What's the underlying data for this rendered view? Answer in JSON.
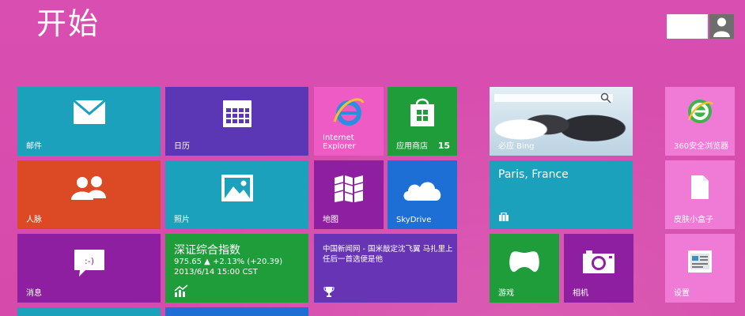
{
  "header": {
    "title": "开始",
    "user_name": ""
  },
  "tiles": {
    "mail": {
      "label": "邮件"
    },
    "calendar": {
      "label": "日历"
    },
    "ie": {
      "label_line1": "Internet",
      "label_line2": "Explorer"
    },
    "store": {
      "label": "应用商店",
      "badge": "15"
    },
    "bing": {
      "label": "必应 Bing"
    },
    "people": {
      "label": "人脉"
    },
    "photos": {
      "label": "照片"
    },
    "maps": {
      "label": "地图"
    },
    "skydrive": {
      "label": "SkyDrive"
    },
    "weather": {
      "city": "Paris, France"
    },
    "messaging": {
      "label": "消息"
    },
    "finance": {
      "title": "深证综合指数",
      "value_line": "975.65  ▲ +2.13% (+20.39)",
      "time_line": "2013/6/14 15:00 CST"
    },
    "news": {
      "text": "中国新闻网 - 国米敲定沈飞翼 马扎里上任后一首选便是他"
    },
    "games": {
      "label": "游戏"
    },
    "camera": {
      "label": "相机"
    },
    "security360": {
      "label": "360安全浏览器"
    },
    "skinbox": {
      "label": "皮肤小盒子"
    },
    "settings": {
      "label": "设置"
    }
  },
  "colors": {
    "background": "#d94eb0",
    "teal": "#1ba1bb",
    "purple": "#5b37b5",
    "pink": "#ee5bc5",
    "green": "#1f9d3a",
    "orange": "#db4a25",
    "magenta": "#8e1fa1",
    "blue": "#1d6fd6"
  }
}
